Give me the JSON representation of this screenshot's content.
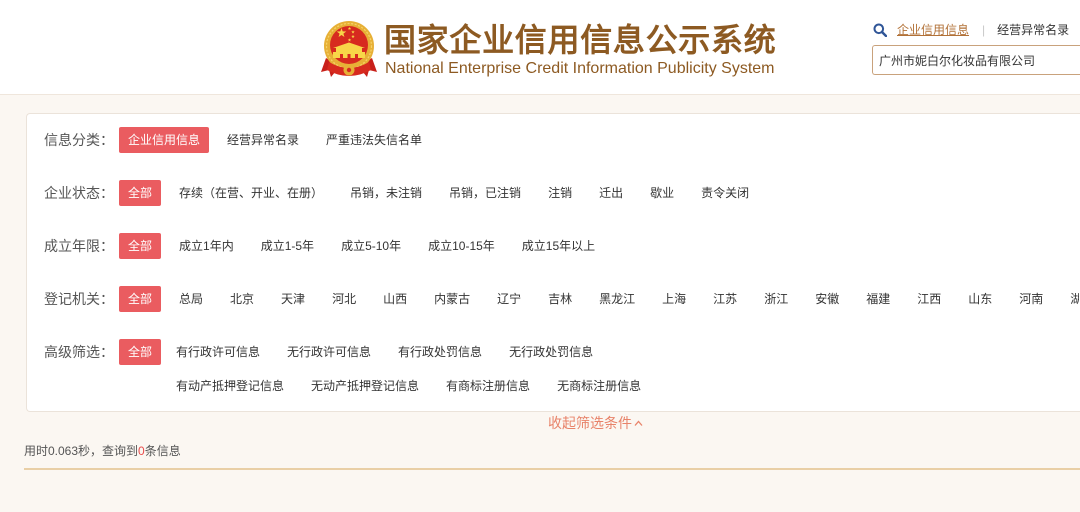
{
  "colors": {
    "accent": "#ea5c60",
    "title": "#8d5a22",
    "link": "#b27137",
    "highlight": "#e8836a",
    "count": "#e94b4b",
    "rule": "#e9cfa6"
  },
  "header": {
    "emblem_icon": "national-emblem-icon",
    "title": "国家企业信用信息公示系统",
    "subtitle": "National Enterprise Credit Information Publicity System",
    "nav": {
      "search_icon": "search-icon",
      "links": [
        {
          "label": "企业信用信息",
          "active": true
        },
        {
          "label": "经营异常名录",
          "active": false
        }
      ],
      "separator": "|"
    },
    "search_input": {
      "value": "广州市妮白尔化妆品有限公司"
    }
  },
  "filters": [
    {
      "label": "信息分类：",
      "selected": 0,
      "options": [
        "企业信用信息",
        "经营异常名录",
        "严重违法失信名单"
      ]
    },
    {
      "label": "企业状态：",
      "selected": 0,
      "options": [
        "全部",
        "存续（在营、开业、在册）",
        "吊销，未注销",
        "吊销，已注销",
        "注销",
        "迁出",
        "歇业",
        "责令关闭"
      ]
    },
    {
      "label": "成立年限：",
      "selected": 0,
      "options": [
        "全部",
        "成立1年内",
        "成立1-5年",
        "成立5-10年",
        "成立10-15年",
        "成立15年以上"
      ]
    },
    {
      "label": "登记机关：",
      "selected": 0,
      "options": [
        "全部",
        "总局",
        "北京",
        "天津",
        "河北",
        "山西",
        "内蒙古",
        "辽宁",
        "吉林",
        "黑龙江",
        "上海",
        "江苏",
        "浙江",
        "安徽",
        "福建",
        "江西",
        "山东",
        "河南",
        "湖"
      ]
    },
    {
      "label": "高级筛选：",
      "selected": 0,
      "options": [
        "全部",
        "有行政许可信息",
        "无行政许可信息",
        "有行政处罚信息",
        "无行政处罚信息",
        "有动产抵押登记信息",
        "无动产抵押登记信息",
        "有商标注册信息",
        "无商标注册信息"
      ]
    }
  ],
  "collapse": {
    "label": "收起筛选条件",
    "icon": "chevron-up-icon"
  },
  "result": {
    "prefix": "用时0.063秒，查询到",
    "count": "0",
    "suffix": "条信息"
  }
}
